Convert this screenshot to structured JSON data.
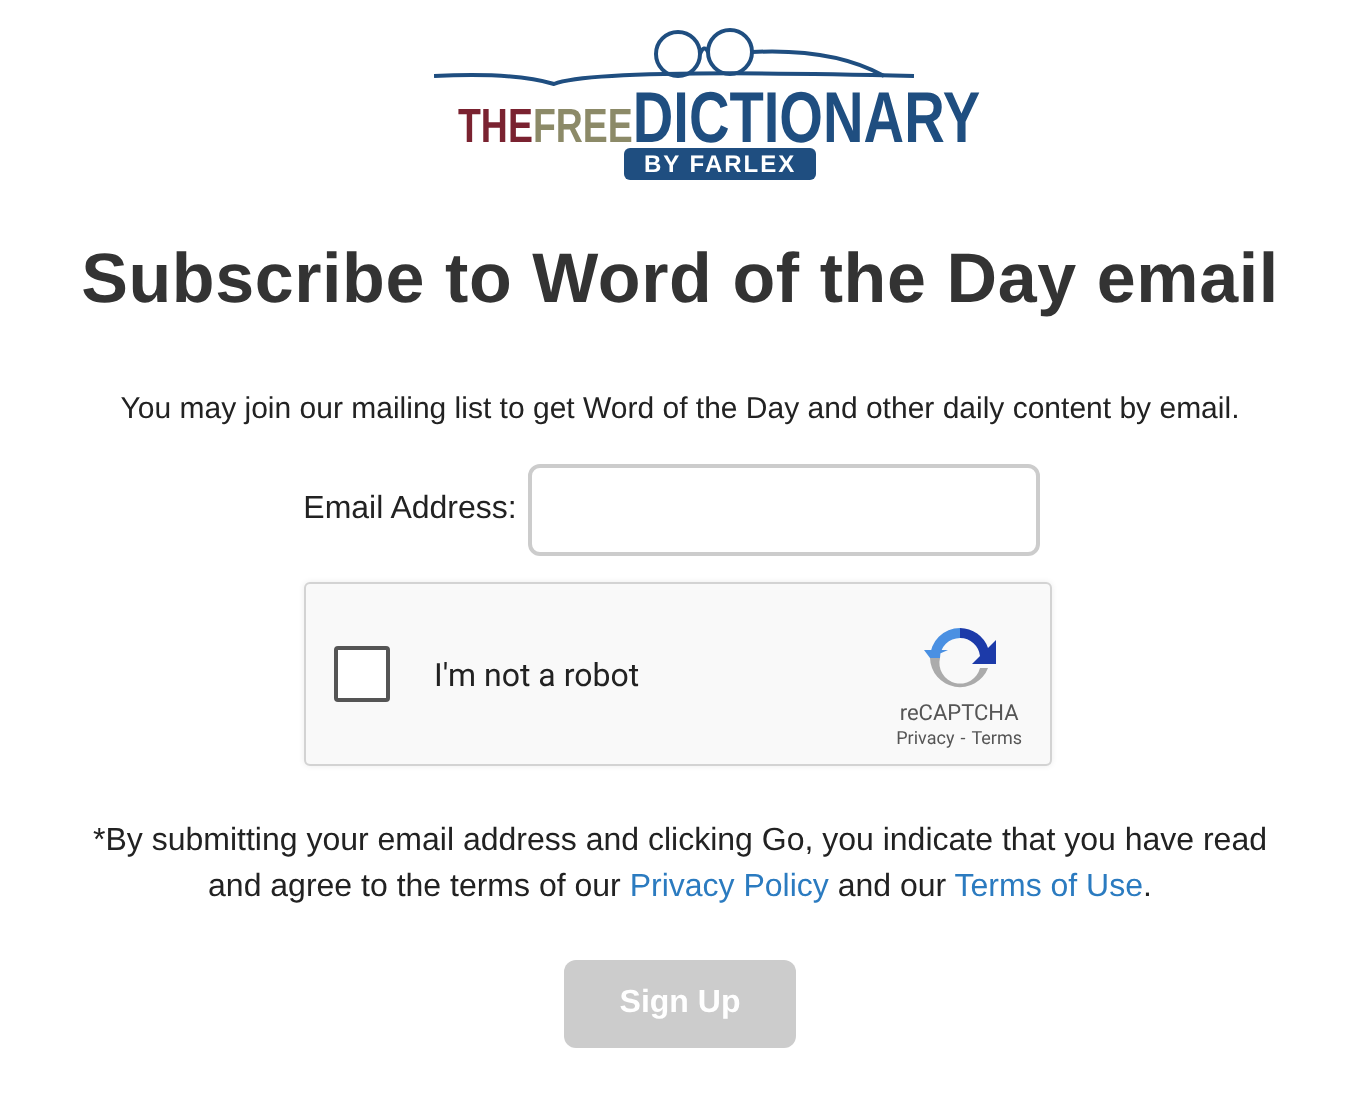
{
  "logo": {
    "words": [
      {
        "text": "THE",
        "color": "#7a2230"
      },
      {
        "text": "FREE",
        "color": "#8c8a68"
      },
      {
        "text": "DICTIONARY",
        "color": "#1f4e80"
      }
    ],
    "byline": "BY FARLEX"
  },
  "heading": "Subscribe to Word of the Day email",
  "intro": "You may join our mailing list to get Word of the Day and other daily content by email.",
  "email": {
    "label": "Email Address:"
  },
  "captcha": {
    "label": "I'm not a robot",
    "checked": false,
    "brand": "reCAPTCHA",
    "privacy": "Privacy",
    "separator": "-",
    "terms": "Terms"
  },
  "disclaimer": [
    {
      "kind": "text",
      "text": "*By submitting your email address and clicking Go, you indicate that you have read and agree to the terms of our "
    },
    {
      "kind": "link",
      "text": "Privacy Policy"
    },
    {
      "kind": "text",
      "text": " and our "
    },
    {
      "kind": "link",
      "text": "Terms of Use"
    },
    {
      "kind": "text",
      "text": "."
    }
  ],
  "submit": {
    "label": "Sign Up",
    "disabled": true
  }
}
